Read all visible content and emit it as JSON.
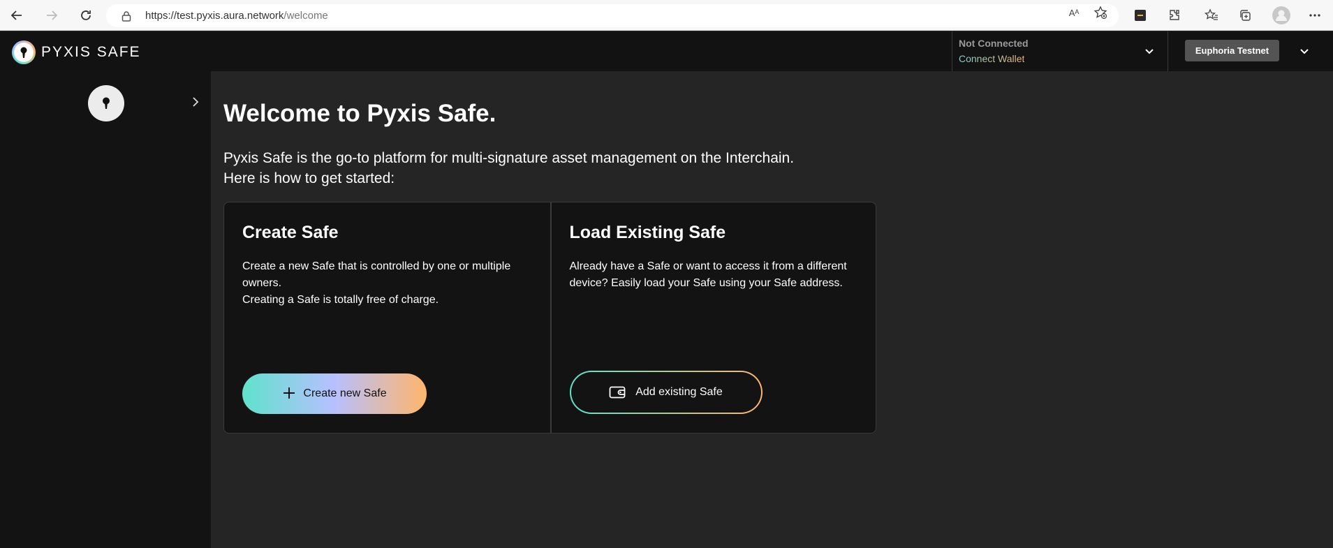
{
  "browser": {
    "url_host": "https://test.pyxis.aura.network",
    "url_path": "/welcome",
    "read_aloud_label": "Aᴬ"
  },
  "header": {
    "logo_text": "PYXIS SAFE",
    "wallet": {
      "status": "Not Connected",
      "connect_label": "Connect Wallet"
    },
    "network": {
      "selected": "Euphoria Testnet"
    }
  },
  "main": {
    "title": "Welcome to Pyxis Safe.",
    "intro_line1": "Pyxis Safe is the go-to platform for multi-signature asset management on the Interchain.",
    "intro_line2": "Here is how to get started:",
    "create_card": {
      "title": "Create Safe",
      "desc_line1": "Create a new Safe that is controlled by one or multiple owners.",
      "desc_line2": "Creating a Safe is totally free of charge.",
      "button_label": "Create new Safe"
    },
    "load_card": {
      "title": "Load Existing Safe",
      "desc": "Already have a Safe or want to access it from a different device? Easily load your Safe using your Safe address.",
      "button_label": "Add existing Safe"
    }
  },
  "colors": {
    "gradient_start": "#5fe2cc",
    "gradient_mid": "#b7c0ff",
    "gradient_end": "#ffb56b",
    "background": "#252525",
    "panel": "#131313"
  }
}
